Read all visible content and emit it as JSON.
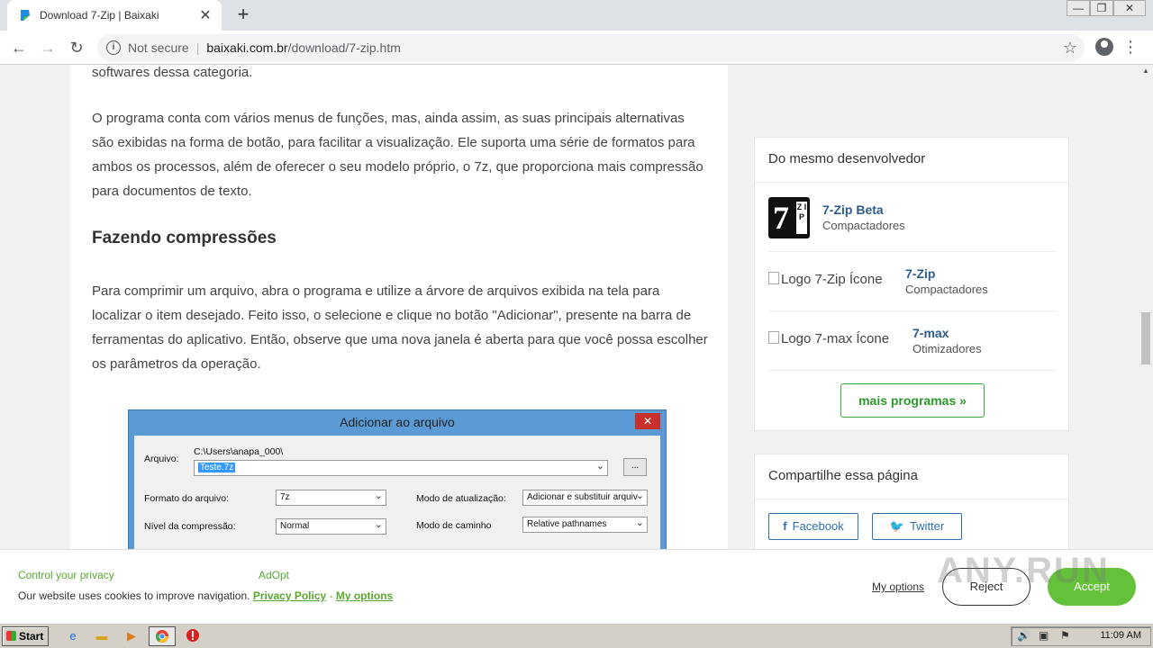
{
  "browser": {
    "tab_title": "Download 7-Zip | Baixaki",
    "tab_close": "✕",
    "new_tab": "+",
    "security_label": "Not secure",
    "url_host": "baixaki.com.br",
    "url_path": "/download/7-zip.htm",
    "back": "←",
    "forward": "→",
    "reload": "↻",
    "star": "☆",
    "menu": "⋮",
    "window_min": "—",
    "window_restore": "❐",
    "window_close": "✕"
  },
  "article": {
    "p0": "softwares dessa categoria.",
    "p1": "O programa conta com vários menus de funções, mas, ainda assim, as suas principais alternativas são exibidas na forma de botão, para facilitar a visualização. Ele suporta uma série de formatos para ambos os processos, além de oferecer o seu modelo próprio, o 7z, que proporciona mais compressão para documentos de texto.",
    "heading": "Fazendo compressões",
    "p2": "Para comprimir um arquivo, abra o programa e utilize a árvore de arquivos exibida na tela para localizar o item desejado. Feito isso, o selecione e clique no botão \"Adicionar\", presente na barra de ferramentas do aplicativo. Então, observe que uma nova janela é aberta para que você possa escolher os parâmetros da operação."
  },
  "dialog": {
    "title": "Adicionar ao arquivo",
    "close": "✕",
    "arquivo_label": "Arquivo:",
    "path": "C:\\Users\\anapa_000\\",
    "filename": "Teste.7z",
    "browse": "...",
    "formato_label": "Formato do arquivo:",
    "formato_value": "7z",
    "nivel_label": "Nível da compressão:",
    "nivel_value": "Normal",
    "modo_atual_label": "Modo de atualização:",
    "modo_atual_value": "Adicionar e substituir arquiv",
    "modo_caminho_label": "Modo de caminho",
    "modo_caminho_value": "Relative pathnames"
  },
  "sidebar": {
    "dev_title": "Do mesmo desenvolvedor",
    "programs": [
      {
        "name": "7-Zip Beta",
        "category": "Compactadores",
        "logo_alt": ""
      },
      {
        "name": "7-Zip",
        "category": "Compactadores",
        "logo_alt": "Logo 7-Zip Ícone"
      },
      {
        "name": "7-max",
        "category": "Otimizadores",
        "logo_alt": "Logo 7-max Ícone"
      }
    ],
    "logo_big": "7",
    "logo_small": "Z I P",
    "more_button": "mais programas »",
    "share_title": "Compartilhe essa página",
    "facebook": "Facebook",
    "twitter": "Twitter"
  },
  "cookie": {
    "control_privacy": "Control your privacy",
    "adopt": "AdOpt",
    "text": "Our website uses cookies to improve navigation.",
    "privacy_policy": "Privacy Policy",
    "separator": "-",
    "my_options_link": "My options",
    "my_options_button": "My options",
    "reject": "Reject",
    "accept": "Accept"
  },
  "watermark": "ANY.RUN",
  "taskbar": {
    "start": "Start",
    "clock": "11:09 AM"
  }
}
